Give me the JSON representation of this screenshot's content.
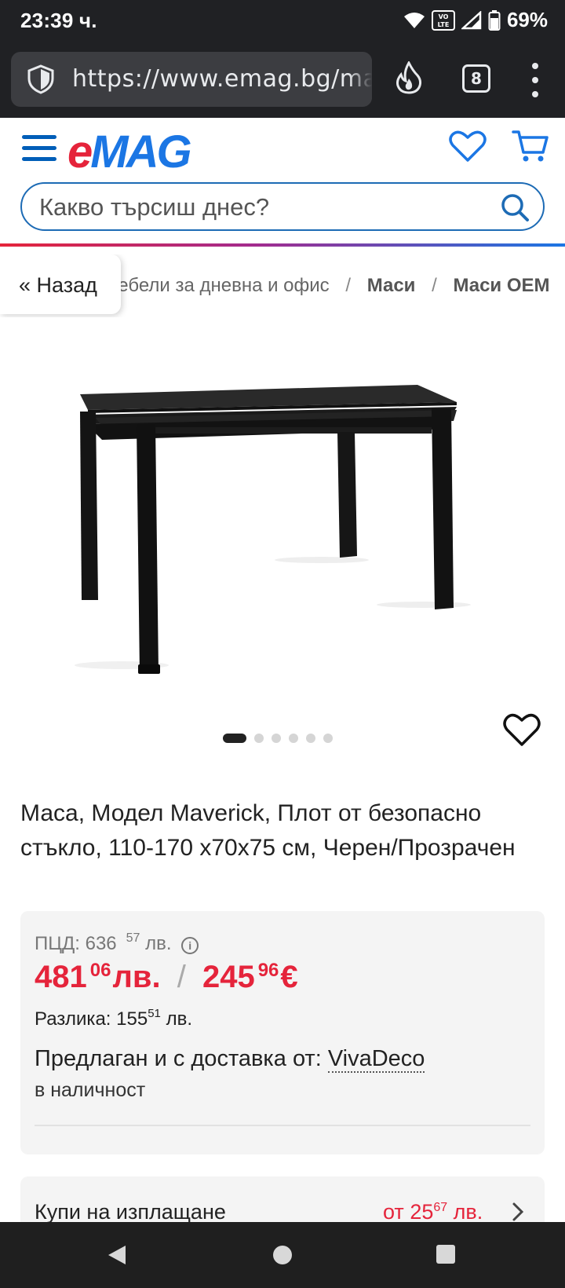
{
  "status_bar": {
    "time": "23:39 ч.",
    "battery": "69%",
    "volte_label": "VO LTE"
  },
  "browser": {
    "url": "https://www.emag.bg/masa-model-maverick",
    "tab_count": "8"
  },
  "header": {
    "logo_e": "e",
    "logo_rest": "MAG",
    "search_placeholder": "Какво търсиш днес?"
  },
  "breadcrumb": {
    "back_label": "« Назад",
    "items": [
      "Мебели за дневна и офис",
      "Маси",
      "Маси OEM"
    ]
  },
  "gallery": {
    "image_alt": "Маса Maverick",
    "slide_count": 6,
    "active_slide": 1
  },
  "product": {
    "title": "Маса, Модел Maverick, Плот от безопасно стъкло, 110-170 х70х75 см, Черен/Прозрачен",
    "rrp_label": "ПЦД:",
    "rrp_int": "636",
    "rrp_dec": "57",
    "rrp_currency": "лв.",
    "price_bgn_int": "481",
    "price_bgn_dec": "06",
    "price_bgn_currency": "лв.",
    "price_slash": "/",
    "price_eur_int": "245",
    "price_eur_dec": "96",
    "price_eur_currency": "€",
    "diff_label": "Разлика:",
    "diff_int": "155",
    "diff_dec": "51",
    "diff_currency": "лв.",
    "seller_prefix": "Предлаган и с доставка от:",
    "seller_name": "VivaDeco",
    "stock": "в наличност"
  },
  "installments": {
    "label": "Купи на изплащане",
    "price_prefix": "от",
    "price_int": "25",
    "price_dec": "67",
    "price_currency": "лв."
  },
  "colors": {
    "brand_red": "#e5243b",
    "brand_blue": "#1b76e4",
    "nav_blue": "#005eb8"
  }
}
